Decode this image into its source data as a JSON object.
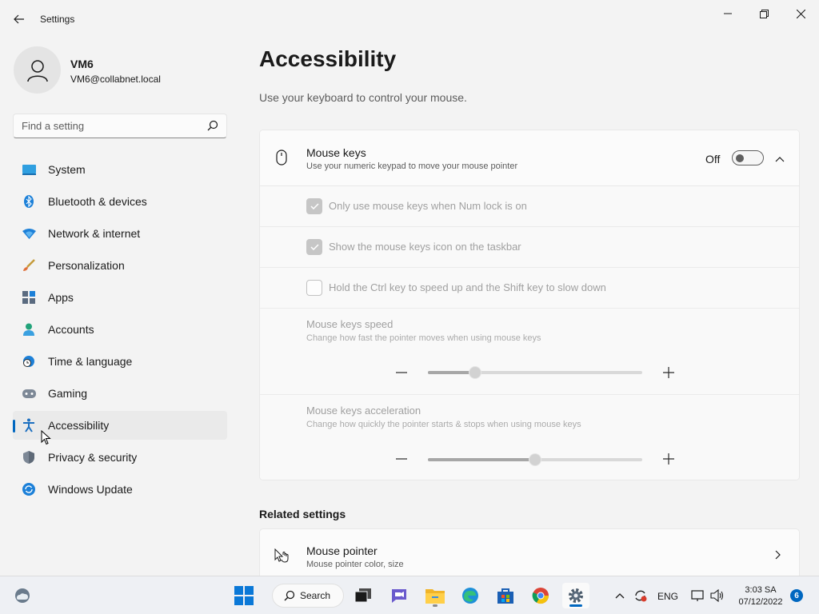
{
  "window": {
    "app_title": "Settings",
    "minimize_icon": "minimize-icon",
    "maximize_icon": "restore-icon",
    "close_icon": "close-icon"
  },
  "profile": {
    "name": "VM6",
    "email": "VM6@collabnet.local"
  },
  "search": {
    "placeholder": "Find a setting"
  },
  "sidebar": {
    "items": [
      {
        "label": "System",
        "icon": "system-icon"
      },
      {
        "label": "Bluetooth & devices",
        "icon": "bluetooth-icon"
      },
      {
        "label": "Network & internet",
        "icon": "wifi-icon"
      },
      {
        "label": "Personalization",
        "icon": "brush-icon"
      },
      {
        "label": "Apps",
        "icon": "apps-icon"
      },
      {
        "label": "Accounts",
        "icon": "accounts-icon"
      },
      {
        "label": "Time & language",
        "icon": "globe-clock-icon"
      },
      {
        "label": "Gaming",
        "icon": "gamepad-icon"
      },
      {
        "label": "Accessibility",
        "icon": "accessibility-icon",
        "active": true
      },
      {
        "label": "Privacy & security",
        "icon": "shield-icon"
      },
      {
        "label": "Windows Update",
        "icon": "update-icon"
      }
    ]
  },
  "main": {
    "title": "Accessibility",
    "subtitle": "Use your keyboard to control your mouse."
  },
  "mouse_keys": {
    "title": "Mouse keys",
    "description": "Use your numeric keypad to move your mouse pointer",
    "toggle_state": "Off",
    "options": [
      {
        "label": "Only use mouse keys when Num lock is on",
        "checked": true
      },
      {
        "label": "Show the mouse keys icon on the taskbar",
        "checked": true
      },
      {
        "label": "Hold the Ctrl key to speed up and the Shift key to slow down",
        "checked": false
      }
    ],
    "speed": {
      "title": "Mouse keys speed",
      "description": "Change how fast the pointer moves when using mouse keys",
      "value_fraction": 0.22
    },
    "acceleration": {
      "title": "Mouse keys acceleration",
      "description": "Change how quickly the pointer starts & stops when using mouse keys",
      "value_fraction": 0.5
    }
  },
  "related": {
    "title": "Related settings",
    "items": [
      {
        "title": "Mouse pointer",
        "description": "Mouse pointer color, size"
      }
    ]
  },
  "taskbar": {
    "search_label": "Search",
    "language": "ENG",
    "time": "3:03 SA",
    "date": "07/12/2022",
    "notification_count": "6"
  },
  "colors": {
    "accent": "#0067c0",
    "background": "#f3f3f3"
  }
}
